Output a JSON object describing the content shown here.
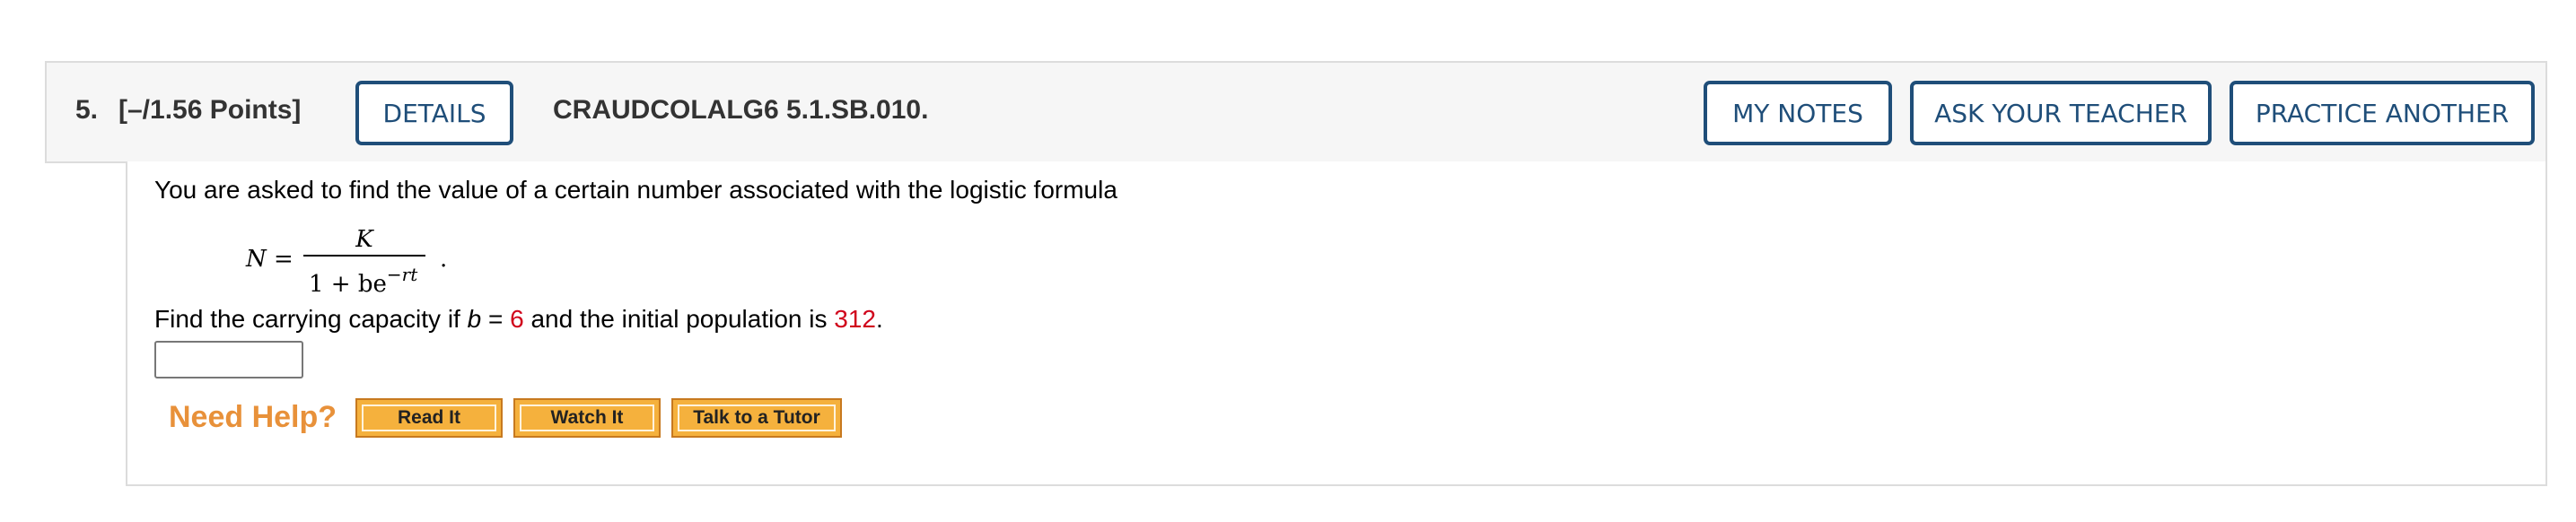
{
  "header": {
    "number": "5.",
    "points": "[–/1.56 Points]",
    "details_label": "DETAILS",
    "code": "CRAUDCOLALG6 5.1.SB.010.",
    "my_notes_label": "MY NOTES",
    "ask_teacher_label": "ASK YOUR TEACHER",
    "practice_label": "PRACTICE ANOTHER"
  },
  "question": {
    "prompt": "You are asked to find the value of a certain number associated with the logistic formula",
    "formula": {
      "lhs": "N =",
      "numerator": "K",
      "denominator_base": "1 + be",
      "denominator_exponent": "−rt",
      "trailing": "."
    },
    "find_text_1": "Find the carrying capacity if ",
    "find_var": "b",
    "find_eq": " = ",
    "b_value": "6",
    "find_text_2": " and the initial population is ",
    "population_value": "312",
    "find_text_3": ".",
    "answer_value": ""
  },
  "help": {
    "title": "Need Help?",
    "read_label": "Read It",
    "watch_label": "Watch It",
    "tutor_label": "Talk to a Tutor"
  },
  "colors": {
    "accent_blue": "#1f4e79",
    "highlight_red": "#d0021b",
    "help_orange": "#e8913a",
    "help_button": "#f5b13d"
  }
}
